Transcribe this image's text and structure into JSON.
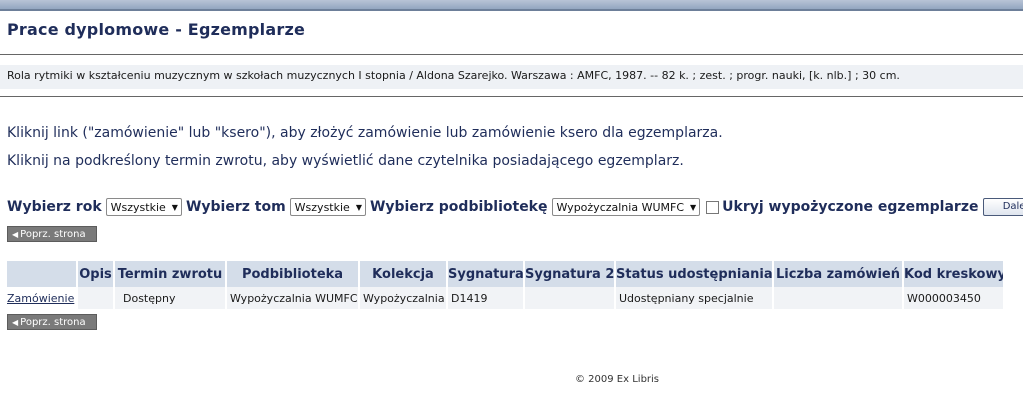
{
  "page": {
    "title": "Prace dyplomowe - Egzemplarze"
  },
  "record": {
    "text": "Rola rytmiki w kształceniu muzycznym w szkołach muzycznych I stopnia / Aldona Szarejko.  Warszawa : AMFC, 1987. --  82 k. ; zest. ; progr. nauki, [k. nlb.] ; 30 cm."
  },
  "instructions": [
    "Kliknij link (\"zamówienie\" lub \"ksero\"), aby złożyć zamówienie lub zamówienie ksero dla egzemplarza.",
    "Kliknij na podkreślony termin zwrotu, aby wyświetlić dane czytelnika posiadającego egzemplarz."
  ],
  "filters": {
    "year_label": "Wybierz rok",
    "year_value": "Wszystkie",
    "volume_label": "Wybierz tom",
    "volume_value": "Wszystkie",
    "sublibrary_label": "Wybierz podbibliotekę",
    "sublibrary_value": "Wypożyczalnia WUMFC",
    "hide_loaned_label": "Ukryj wypożyczone egzemplarze",
    "hide_loaned_checked": false,
    "submit_label": "Dalej"
  },
  "pagination": {
    "prev_label": "Poprz. strona"
  },
  "table": {
    "headers": [
      "",
      "Opis",
      "Termin zwrotu",
      "Podbiblioteka",
      "Kolekcja",
      "Sygnatura",
      "Sygnatura 2",
      "Status udostępniania",
      "Liczba zamówień",
      "Kod kreskowy"
    ],
    "rows": [
      {
        "action": "Zamówienie",
        "opis": "",
        "termin": "Dostępny",
        "podbiblioteka": "Wypożyczalnia WUMFC",
        "kolekcja": "Wypożyczalnia",
        "sygnatura": "D1419",
        "sygnatura2": "",
        "status": "Udostępniany specjalnie",
        "liczba": "",
        "kod": "W000003450"
      }
    ]
  },
  "footer": {
    "copyright": "© 2009 Ex Libris"
  },
  "colors": {
    "heading": "#1f2d5a",
    "table_header_bg": "#d4dde9",
    "button_gray": "#7a7a7a"
  }
}
